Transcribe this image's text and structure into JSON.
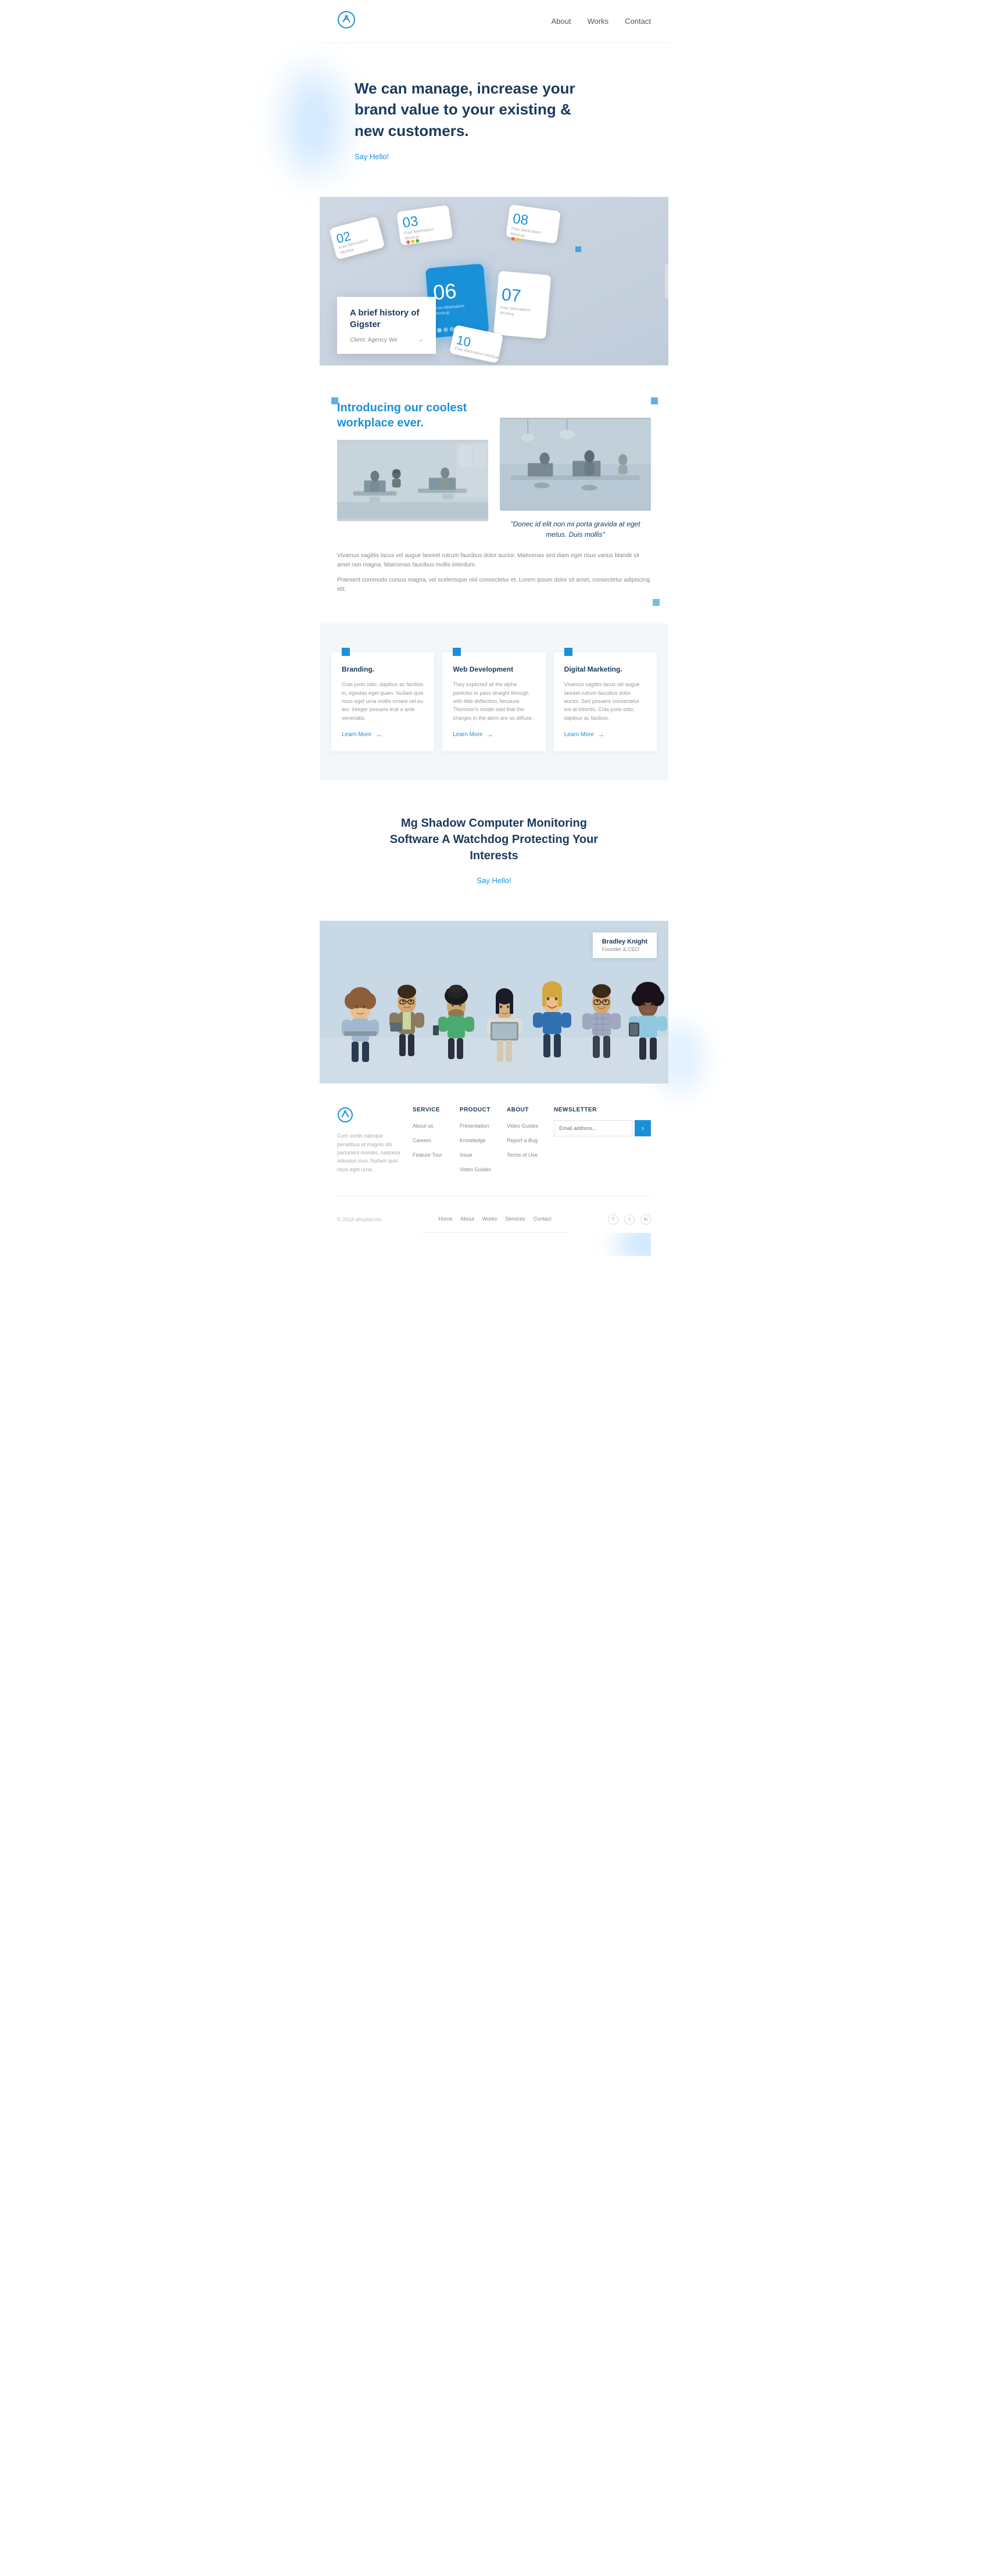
{
  "nav": {
    "links": [
      {
        "label": "About",
        "href": "#about"
      },
      {
        "label": "Works",
        "href": "#works"
      },
      {
        "label": "Contact",
        "href": "#contact"
      }
    ]
  },
  "hero": {
    "headline": "We can manage, increase your brand value to your existing & new customers.",
    "cta_label": "Say Hello!"
  },
  "showcase": {
    "case_study_title": "A brief history of Gigster",
    "case_study_client": "Client: Agency We"
  },
  "phones": [
    {
      "num": "02",
      "label": "Free Minimalism\nMockup"
    },
    {
      "num": "03",
      "label": "Free Minimalism\nMockup"
    },
    {
      "num": "06",
      "label": "Free Minimalism\nMockup",
      "blue": true
    },
    {
      "num": "07",
      "label": "Free Minimalism\nMockup"
    },
    {
      "num": "08",
      "label": "Free Minimalism\nMockup"
    },
    {
      "num": "10",
      "label": "Free Minimalism\nMockup"
    }
  ],
  "workplace": {
    "heading": "Introducing our coolest workplace ever.",
    "text1": "Vivamus sagittis lacus vel augue laoreet rutrum faucibus dolor auctor. Maecenas sed diam eget risus varius blandit sit amet non magna. Maecenas faucibus mollis interdum.",
    "text2": "Praesent commodo cursus magna, vel scelerisque nisl consectetur et. Lorem ipsum dolor sit amet, consectetur adipiscing elit.",
    "quote": "\"Donec id elit non mi porta gravida at eget metus. Duis mollis\""
  },
  "services": [
    {
      "title": "Branding.",
      "desc": "Cras justo odio, dapibus ac facilisis in, egestas eget quam. Nullam quis risus eget urna mollis ornare vel eu leo. Integer posuere erat a ante venenatis.",
      "link": "Learn More"
    },
    {
      "title": "Web Development",
      "desc": "They expected all the alpha particles to pass straight through with little deflection, because Thomson's model said that the charges in the atom are so diffuse.",
      "link": "Learn More"
    },
    {
      "title": "Digital Marketing.",
      "desc": "Vivamus sagittis lacus vel augue laoreet rutrum faucibus dolor auctor. Sed posuere consectetur est at lobortis. Cras justo odio, dapibus ac facilisis.",
      "link": "Learn More"
    }
  ],
  "cta": {
    "heading": "Mg Shadow Computer Monitoring Software A Watchdog Protecting Your Interests",
    "cta_label": "Say Hello!"
  },
  "team": {
    "name": "Bradley Knight",
    "role": "Founder & CEO"
  },
  "footer": {
    "brand_text": "Cum sociis natoque penatibus et magnis dis parturient montes, nascetur ridiculus mus. Nullam quis risus eget urna.",
    "service_col": {
      "heading": "SERVICE",
      "links": [
        "About us",
        "Careers",
        "Feature Tour"
      ]
    },
    "product_col": {
      "heading": "PRODUCT",
      "links": [
        "Presentation",
        "Knowledge",
        "Issue",
        "Video Guides"
      ]
    },
    "about_col": {
      "heading": "ABOUT",
      "links": [
        "Video Guides",
        "Report a Bug",
        "Terms of Use"
      ]
    },
    "newsletter_col": {
      "heading": "NEWSLETTER",
      "placeholder": "Email address..."
    },
    "bottom": {
      "copyright": "© 2018 abcplan.inc",
      "nav": [
        "Home",
        "About",
        "Works",
        "Services",
        "Contact"
      ]
    }
  }
}
